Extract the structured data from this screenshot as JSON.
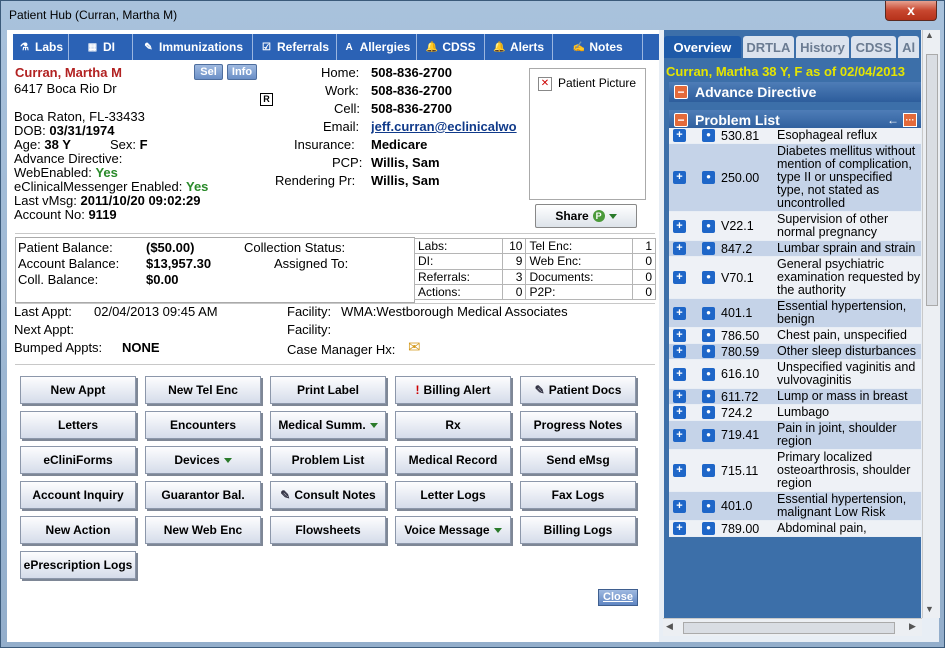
{
  "window": {
    "title": "Patient Hub (Curran, Martha M)",
    "close": "x"
  },
  "tabs": [
    {
      "label": "Labs",
      "icon": "labs-icon",
      "glyph": "⚗"
    },
    {
      "label": "DI",
      "icon": "di-icon",
      "glyph": "▦"
    },
    {
      "label": "Immunizations",
      "icon": "syringe-icon",
      "glyph": "✎"
    },
    {
      "label": "Referrals",
      "icon": "referrals-icon",
      "glyph": "☑"
    },
    {
      "label": "Allergies",
      "icon": "allergies-icon",
      "glyph": "A"
    },
    {
      "label": "CDSS",
      "icon": "bell-icon",
      "glyph": "🔔"
    },
    {
      "label": "Alerts",
      "icon": "bell-icon",
      "glyph": "🔔"
    },
    {
      "label": "Notes",
      "icon": "notes-icon",
      "glyph": "✍"
    }
  ],
  "patient": {
    "name": "Curran, Martha M",
    "address1": "6417 Boca Rio Dr",
    "address2": "Boca Raton, FL-33433",
    "dob_label": "DOB:",
    "dob": "03/31/1974",
    "age_label": "Age:",
    "age": "38 Y",
    "sex_label": "Sex:",
    "sex": "F",
    "advance_directive_label": "Advance Directive:",
    "webenabled_label": "WebEnabled:",
    "webenabled": "Yes",
    "messenger_label": "eClinicalMessenger Enabled:",
    "messenger": "Yes",
    "last_vmsg_label": "Last vMsg:",
    "last_vmsg": "2011/10/20 09:02:29",
    "account_label": "Account No:",
    "account": "9119",
    "sel": "Sel",
    "info": "Info",
    "r": "R"
  },
  "contact": {
    "home_label": "Home:",
    "home": "508-836-2700",
    "work_label": "Work:",
    "work": "508-836-2700",
    "cell_label": "Cell:",
    "cell": "508-836-2700",
    "email_label": "Email:",
    "email": "jeff.curran@eclinicalwo",
    "insurance_label": "Insurance:",
    "insurance": "Medicare",
    "pcp_label": "PCP:",
    "pcp": "Willis, Sam",
    "rendering_label": "Rendering Pr:",
    "rendering": "Willis, Sam"
  },
  "photo_label": "Patient Picture",
  "share_label": "Share",
  "share_badge": "P",
  "balance": {
    "patient_label": "Patient Balance:",
    "patient": "($50.00)",
    "account_label": "Account Balance:",
    "account": "$13,957.30",
    "coll_label": "Coll. Balance:",
    "coll": "$0.00",
    "collection_status_label": "Collection Status:",
    "assigned_label": "Assigned To:"
  },
  "counts": [
    [
      "Labs:",
      "10",
      "Tel Enc:",
      "1"
    ],
    [
      "DI:",
      "9",
      "Web Enc:",
      "0"
    ],
    [
      "Referrals:",
      "3",
      "Documents:",
      "0"
    ],
    [
      "Actions:",
      "0",
      "P2P:",
      "0"
    ]
  ],
  "appointments": {
    "last_label": "Last Appt:",
    "last": "02/04/2013 09:45 AM",
    "next_label": "Next Appt:",
    "bumped_label": "Bumped Appts:",
    "bumped": "NONE",
    "facility_label": "Facility:",
    "facility": "WMA:Westborough Medical Associates",
    "facility2_label": "Facility:",
    "case_manager_label": "Case Manager Hx:"
  },
  "buttons": [
    [
      "New Appt",
      "New Tel Enc",
      "Print Label",
      "Billing Alert",
      "Patient Docs"
    ],
    [
      "Letters",
      "Encounters",
      "Medical Summ.",
      "Rx",
      "Progress Notes"
    ],
    [
      "eCliniForms",
      "Devices",
      "Problem List",
      "Medical Record",
      "Send eMsg"
    ],
    [
      "Account Inquiry",
      "Guarantor Bal.",
      "Consult Notes",
      "Letter Logs",
      "Fax Logs"
    ],
    [
      "New Action",
      "New Web Enc",
      "Flowsheets",
      "Voice Message",
      "Billing Logs"
    ],
    [
      "ePrescription Logs"
    ]
  ],
  "close_label": "Close",
  "right_tabs": [
    "Overview",
    "DRTLA",
    "History",
    "CDSS",
    "Al"
  ],
  "overview_header": "Curran, Martha 38 Y, F as of 02/04/2013",
  "advance_directive_title": "Advance Directive",
  "problem_list_title": "Problem List",
  "problems": [
    {
      "code": "530.81",
      "desc": "Esophageal reflux"
    },
    {
      "code": "250.00",
      "desc": "Diabetes mellitus without mention of complication, type II or unspecified type, not stated as uncontrolled"
    },
    {
      "code": "V22.1",
      "desc": "Supervision of other normal pregnancy"
    },
    {
      "code": "847.2",
      "desc": "Lumbar sprain and strain"
    },
    {
      "code": "V70.1",
      "desc": "General psychiatric examination requested by the authority"
    },
    {
      "code": "401.1",
      "desc": "Essential hypertension, benign"
    },
    {
      "code": "786.50",
      "desc": "Chest pain, unspecified"
    },
    {
      "code": "780.59",
      "desc": "Other sleep disturbances"
    },
    {
      "code": "616.10",
      "desc": "Unspecified vaginitis and vulvovaginitis"
    },
    {
      "code": "611.72",
      "desc": "Lump or mass in breast"
    },
    {
      "code": "724.2",
      "desc": "Lumbago"
    },
    {
      "code": "719.41",
      "desc": "Pain in joint, shoulder region"
    },
    {
      "code": "715.11",
      "desc": "Primary localized osteoarthrosis, shoulder region"
    },
    {
      "code": "401.0",
      "desc": "Essential hypertension, malignant Low Risk"
    },
    {
      "code": "789.00",
      "desc": "Abdominal pain,"
    }
  ]
}
